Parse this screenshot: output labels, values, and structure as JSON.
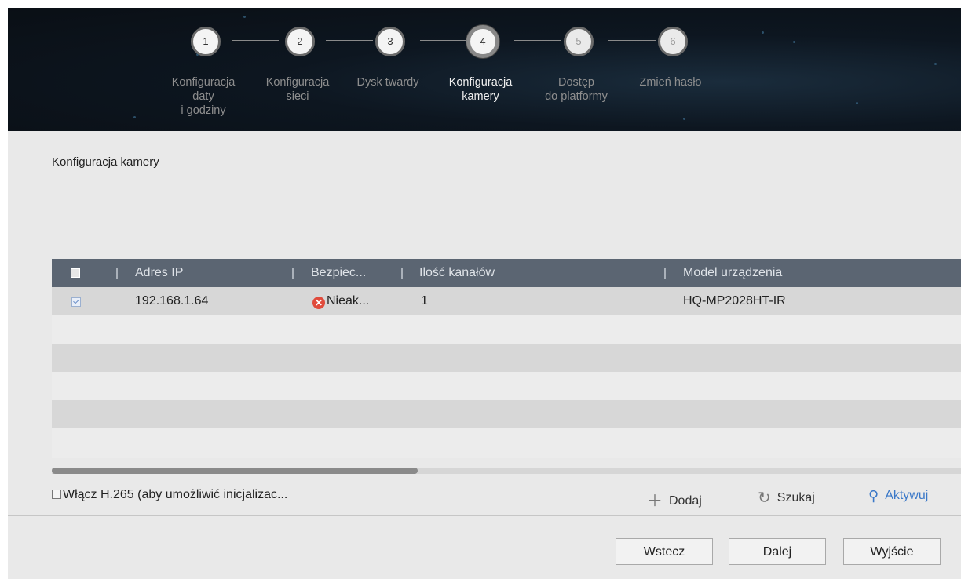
{
  "wizard": {
    "steps": [
      {
        "number": "1",
        "label_lines": [
          "Konfiguracja",
          "daty",
          "i godziny"
        ]
      },
      {
        "number": "2",
        "label_lines": [
          "Konfiguracja",
          "sieci"
        ]
      },
      {
        "number": "3",
        "label_lines": [
          "Dysk twardy"
        ]
      },
      {
        "number": "4",
        "label_lines": [
          "Konfiguracja",
          "kamery"
        ]
      },
      {
        "number": "5",
        "label_lines": [
          "Dostęp",
          "do platformy"
        ]
      },
      {
        "number": "6",
        "label_lines": [
          "Zmień hasło"
        ]
      }
    ],
    "active_step": 4
  },
  "page": {
    "title": "Konfiguracja kamery"
  },
  "table": {
    "columns": [
      "Adres IP",
      "Bezpiec...",
      "Ilość kanałów",
      "Model urządzenia"
    ],
    "rows": [
      {
        "checked": true,
        "ip": "192.168.1.64",
        "security": "Nieak...",
        "security_icon": "error-icon",
        "channels": "1",
        "model": "HQ-MP2028HT-IR"
      }
    ],
    "empty_rows": 5
  },
  "h265": {
    "label": "Włącz H.265 (aby umożliwić inicjalizac...",
    "checked": false
  },
  "actions": {
    "add": "Dodaj",
    "search": "Szukaj",
    "activate": "Aktywuj"
  },
  "buttons": {
    "back": "Wstecz",
    "next": "Dalej",
    "exit": "Wyjście"
  },
  "colors": {
    "header_bg": "#0d1620",
    "table_header": "#5b6572",
    "error": "#e04b3c",
    "link": "#3a78c8"
  }
}
